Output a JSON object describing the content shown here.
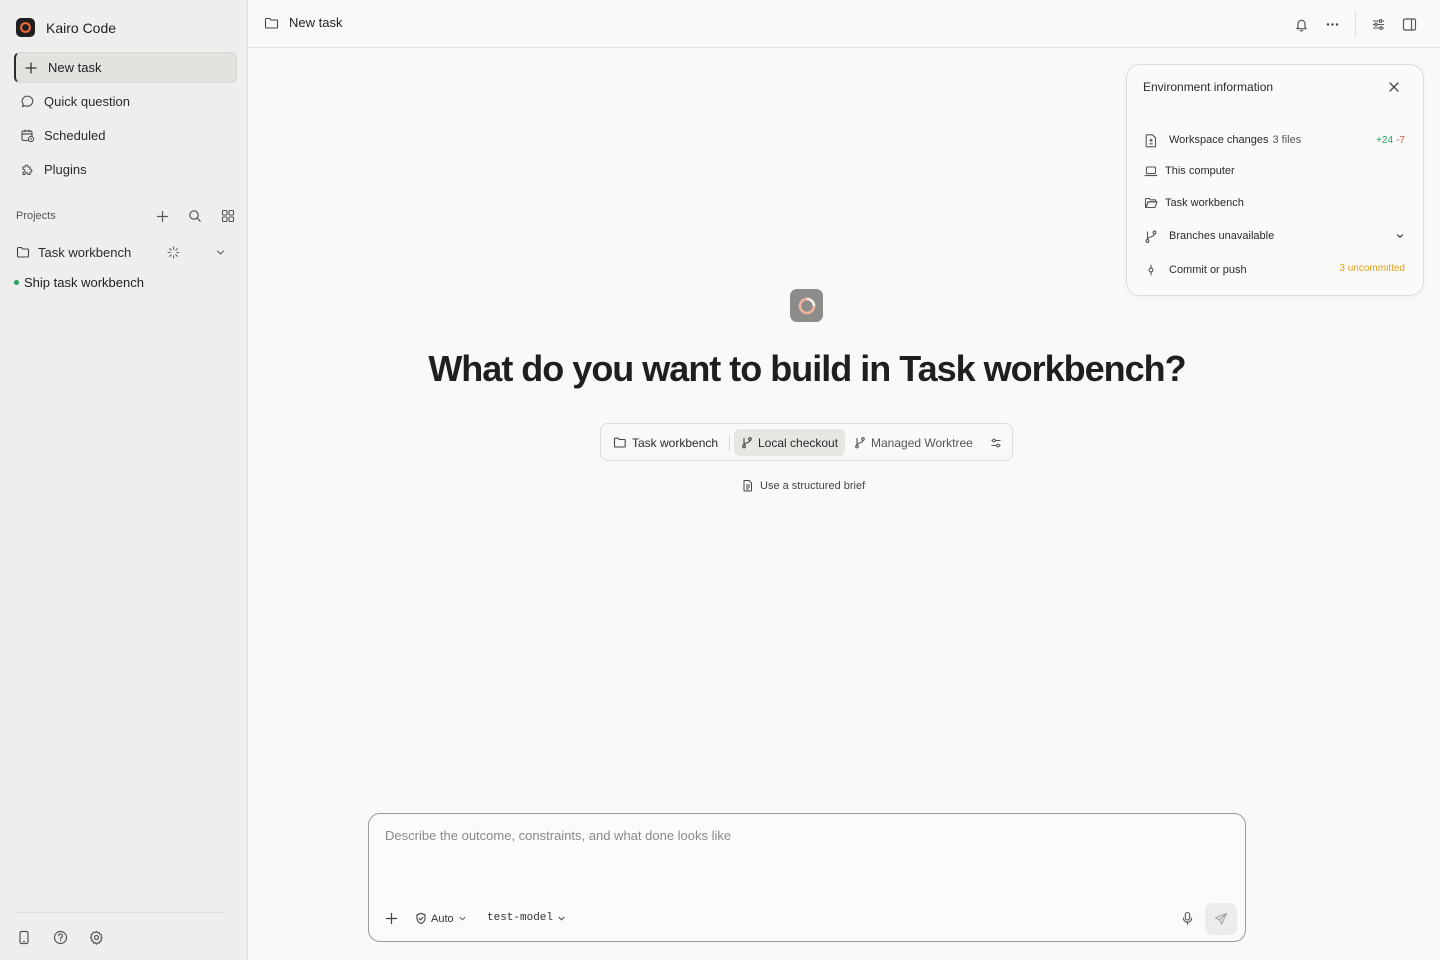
{
  "app": {
    "name": "Kairo Code"
  },
  "sidebar": {
    "nav": [
      {
        "label": "New task",
        "icon": "plus-icon",
        "active": true
      },
      {
        "label": "Quick question",
        "icon": "chat-bubble-icon"
      },
      {
        "label": "Scheduled",
        "icon": "calendar-clock-icon"
      },
      {
        "label": "Plugins",
        "icon": "puzzle-icon"
      }
    ],
    "projects_label": "Projects",
    "project": {
      "name": "Task workbench"
    },
    "task": {
      "name": "Ship task workbench",
      "status_color": "#2f9e62"
    }
  },
  "topbar": {
    "title": "New task"
  },
  "env": {
    "title": "Environment information",
    "workspace": {
      "label": "Workspace changes",
      "files": "3 files",
      "added": "+24",
      "removed": "-7"
    },
    "location": "This computer",
    "folder": "Task workbench",
    "branches": "Branches unavailable",
    "commit": {
      "label": "Commit or push",
      "status": "3 uncommitted"
    }
  },
  "main": {
    "headline": "What do you want to build in Task workbench?",
    "modes": {
      "project": "Task workbench",
      "local": "Local checkout",
      "managed": "Managed Worktree"
    },
    "brief": "Use a structured brief"
  },
  "composer": {
    "placeholder": "Describe the outcome, constraints, and what done looks like",
    "permission": "Auto",
    "model": "test-model"
  },
  "colors": {
    "accent": "#1f1f1f",
    "success": "#2f9e62",
    "danger": "#d9534f",
    "warning": "#e0a022"
  }
}
